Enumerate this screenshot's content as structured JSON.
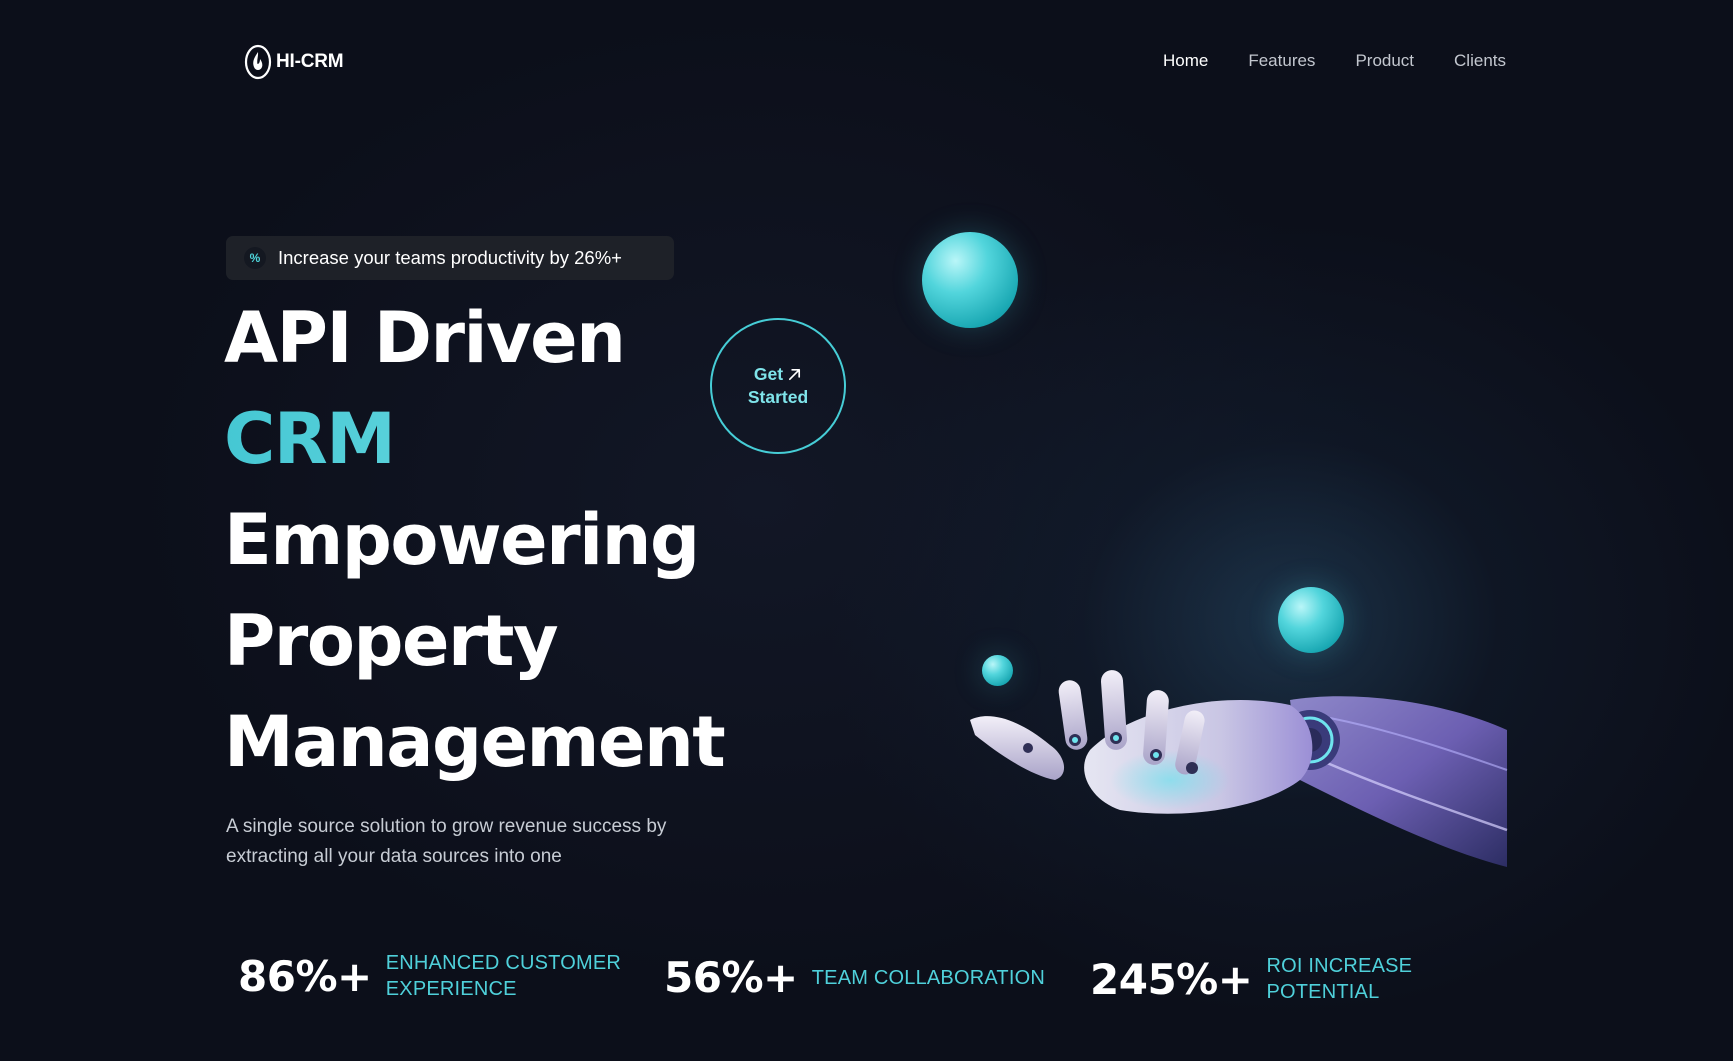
{
  "header": {
    "logo_text": "HI-CRM",
    "logo_icon": "flame-icon",
    "nav": [
      {
        "label": "Home",
        "active": true
      },
      {
        "label": "Features",
        "active": false
      },
      {
        "label": "Product",
        "active": false
      },
      {
        "label": "Clients",
        "active": false
      }
    ]
  },
  "hero": {
    "badge": {
      "icon": "percent-icon",
      "text": "Increase your teams productivity by 26%+"
    },
    "headline": {
      "line1": "API Driven",
      "line2": "CRM",
      "line3": "Empowering",
      "line4": "Property",
      "line5": "Management"
    },
    "subtitle": "A single source solution to grow revenue success by extracting all your data sources into one",
    "cta": {
      "line1": "Get",
      "line2": "Started",
      "icon": "arrow-up-right-icon"
    },
    "illustration": "robotic-hand-with-spheres"
  },
  "stats": [
    {
      "value": "86%+",
      "label": "ENHANCED CUSTOMER EXPERIENCE"
    },
    {
      "value": "56%+",
      "label": "TEAM COLLABORATION"
    },
    {
      "value": "245%+",
      "label": "ROI INCREASE POTENTIAL"
    }
  ],
  "colors": {
    "background": "#0c0f1a",
    "accent": "#46cdd6",
    "accent_light": "#7fe4ea",
    "badge_bg": "#1e2128"
  }
}
